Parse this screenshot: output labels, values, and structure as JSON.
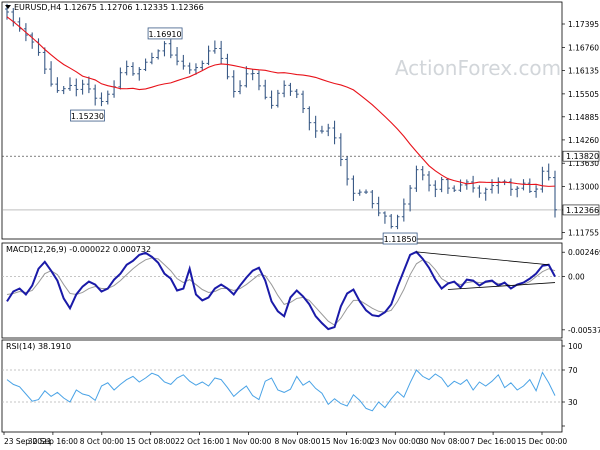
{
  "colors": {
    "candle": "#3a5a86",
    "ma": "#e8121a",
    "macd": "#1a1aa8",
    "signal": "#9a9a9a",
    "rsi": "#4aa3e6",
    "grid": "#b4b4b4",
    "watermark": "#d2d6da"
  },
  "watermark": "ActionForex.com",
  "chart_data": [
    {
      "type": "candlestick",
      "title": "EURUSD,H4  1.12675 1.12706 1.12335 1.12366",
      "ylim": [
        1.1158,
        1.1799
      ],
      "ytick_labels": [
        "1.17395",
        "1.16760",
        "1.16135",
        "1.15505",
        "1.14885",
        "1.14260",
        "1.13630",
        "1.13000",
        "1.12366",
        "1.11755"
      ],
      "ytick_values": [
        1.17395,
        1.1676,
        1.16135,
        1.15505,
        1.14885,
        1.1426,
        1.1363,
        1.13,
        1.12366,
        1.11755
      ],
      "current_price_label": "1.12366",
      "level_price_label": "1.13820",
      "close_path": [
        1.1772,
        1.1746,
        1.1728,
        1.1712,
        1.1695,
        1.1672,
        1.1631,
        1.1582,
        1.1566,
        1.1548,
        1.1588,
        1.1556,
        1.1569,
        1.1583,
        1.1551,
        1.1532,
        1.1529,
        1.1557,
        1.1573,
        1.1615,
        1.1626,
        1.1603,
        1.1617,
        1.1636,
        1.1648,
        1.1664,
        1.1691,
        1.1659,
        1.1641,
        1.1632,
        1.1611,
        1.1624,
        1.1618,
        1.1653,
        1.1682,
        1.1665,
        1.1632,
        1.1574,
        1.1548,
        1.1583,
        1.1612,
        1.1604,
        1.1566,
        1.1538,
        1.1518,
        1.1553,
        1.1574,
        1.1558,
        1.1554,
        1.1517,
        1.1478,
        1.1452,
        1.1445,
        1.1461,
        1.1453,
        1.1398,
        1.1341,
        1.1298,
        1.1267,
        1.1298,
        1.1277,
        1.1242,
        1.1223,
        1.1219,
        1.1185,
        1.1224,
        1.1256,
        1.1298,
        1.1346,
        1.1332,
        1.1305,
        1.1288,
        1.1323,
        1.1298,
        1.1287,
        1.1298,
        1.1318,
        1.1302,
        1.1287,
        1.1276,
        1.1309,
        1.1297,
        1.1324,
        1.1306,
        1.1286,
        1.1299,
        1.1312,
        1.1281,
        1.1295,
        1.1346,
        1.1323,
        1.1237
      ],
      "ma_path": [
        1.1759,
        1.1739,
        1.1716,
        1.1694,
        1.1669,
        1.1647,
        1.1628,
        1.1614,
        1.1596,
        1.1591,
        1.1575,
        1.157,
        1.1563,
        1.1566,
        1.1561,
        1.1568,
        1.1576,
        1.158,
        1.1589,
        1.1597,
        1.1609,
        1.1623,
        1.1632,
        1.163,
        1.1625,
        1.1619,
        1.1616,
        1.1614,
        1.1607,
        1.1608,
        1.1603,
        1.1601,
        1.1596,
        1.1587,
        1.1579,
        1.1573,
        1.1562,
        1.1542,
        1.1521,
        1.1497,
        1.1472,
        1.1445,
        1.1412,
        1.1382,
        1.1353,
        1.1334,
        1.1319,
        1.1313,
        1.1306,
        1.1312,
        1.1311,
        1.1311,
        1.1312,
        1.1308,
        1.1305,
        1.1306,
        1.13,
        1.1301
      ],
      "annotations": [
        {
          "label": "1.16910",
          "price": 1.1691
        },
        {
          "label": "1.15230",
          "price": 1.1523
        },
        {
          "label": "1.11850",
          "price": 1.1185
        }
      ],
      "horizontal_lines": [
        {
          "price": 1.1382,
          "style": "dashed"
        },
        {
          "price": 1.12366,
          "style": "solid"
        }
      ]
    },
    {
      "type": "line",
      "title": "MACD(12,26,9) -0.000022 0.000732",
      "ylim": [
        -0.0062,
        0.0034
      ],
      "ytick_labels": [
        "0.002469",
        "0.00",
        "-0.005375"
      ],
      "ytick_values": [
        0.002469,
        0.0,
        -0.005375
      ],
      "series": [
        {
          "name": "MACD",
          "values": [
            -0.0025,
            -0.0015,
            -0.0012,
            -0.0018,
            -0.0009,
            0.0008,
            0.0015,
            0.0006,
            -0.0004,
            -0.0022,
            -0.0032,
            -0.0018,
            -0.001,
            -0.0005,
            -0.0008,
            -0.0015,
            -0.0012,
            -0.0003,
            0.0003,
            0.0012,
            0.0016,
            0.0022,
            0.0024,
            0.002,
            0.0014,
            0.0003,
            -0.0002,
            -0.0014,
            -0.0012,
            0.0008,
            -0.0018,
            -0.0024,
            -0.0021,
            -0.0012,
            -0.0008,
            -0.0012,
            -0.0018,
            -0.0009,
            -0.0001,
            0.0006,
            0.0009,
            -0.0004,
            -0.0025,
            -0.0035,
            -0.004,
            -0.0021,
            -0.0014,
            -0.002,
            -0.0028,
            -0.004,
            -0.0047,
            -0.0053,
            -0.0051,
            -0.003,
            -0.0017,
            -0.0013,
            -0.0025,
            -0.0034,
            -0.0039,
            -0.004,
            -0.0036,
            -0.0028,
            -0.001,
            0.0006,
            0.0022,
            0.0025,
            0.0018,
            0.0009,
            -0.0003,
            -0.0012,
            -0.0007,
            -0.0005,
            -0.0011,
            -0.0003,
            -0.0004,
            -0.0009,
            -0.0005,
            -0.0004,
            -0.0009,
            -0.0006,
            -0.0012,
            -0.0008,
            -0.0006,
            -0.0002,
            0.0003,
            0.0011,
            0.0012,
            0.0
          ]
        },
        {
          "name": "Signal",
          "values": [
            -0.0018,
            -0.0017,
            -0.0015,
            -0.0016,
            -0.0014,
            -0.0006,
            0.0003,
            0.0006,
            0.0002,
            -0.0008,
            -0.0017,
            -0.0018,
            -0.0016,
            -0.0012,
            -0.001,
            -0.0012,
            -0.0012,
            -0.0009,
            -0.0004,
            0.0002,
            0.0008,
            0.0013,
            0.0017,
            0.0019,
            0.0018,
            0.0012,
            0.0006,
            -0.0002,
            -0.0006,
            -0.0003,
            -0.0008,
            -0.0013,
            -0.0016,
            -0.0015,
            -0.0012,
            -0.0012,
            -0.0014,
            -0.0012,
            -0.0008,
            -0.0003,
            0.0002,
            0.0001,
            -0.0008,
            -0.0019,
            -0.0028,
            -0.0026,
            -0.0022,
            -0.0021,
            -0.0024,
            -0.0031,
            -0.0038,
            -0.0045,
            -0.0049,
            -0.0042,
            -0.0032,
            -0.0024,
            -0.0024,
            -0.0028,
            -0.0032,
            -0.0035,
            -0.0036,
            -0.0034,
            -0.0025,
            -0.0013,
            0.0002,
            0.0013,
            0.0017,
            0.0014,
            0.0007,
            -0.0002,
            -0.0006,
            -0.0006,
            -0.0008,
            -0.0006,
            -0.0005,
            -0.0006,
            -0.0006,
            -0.0005,
            -0.0007,
            -0.0007,
            -0.0009,
            -0.0009,
            -0.0008,
            -0.0005,
            0.0,
            0.0005,
            0.0008,
            0.0006
          ]
        }
      ]
    },
    {
      "type": "line",
      "title": "RSI(14) 38.1910",
      "ylim": [
        0,
        100
      ],
      "ytick_labels": [
        "100",
        "70",
        "30",
        "0"
      ],
      "ytick_values": [
        100,
        70,
        30,
        0
      ],
      "series": [
        {
          "name": "RSI",
          "values": [
            58,
            52,
            49,
            40,
            31,
            33,
            44,
            37,
            42,
            35,
            30,
            45,
            40,
            38,
            32,
            50,
            54,
            45,
            52,
            58,
            62,
            55,
            60,
            66,
            63,
            55,
            52,
            60,
            64,
            56,
            51,
            55,
            50,
            60,
            58,
            48,
            37,
            44,
            50,
            38,
            33,
            56,
            60,
            45,
            42,
            46,
            62,
            51,
            56,
            47,
            41,
            27,
            34,
            28,
            25,
            39,
            32,
            22,
            19,
            30,
            23,
            34,
            43,
            36,
            54,
            70,
            62,
            58,
            65,
            60,
            49,
            56,
            52,
            58,
            45,
            55,
            50,
            56,
            64,
            48,
            54,
            45,
            50,
            58,
            44,
            67,
            54,
            38
          ]
        }
      ]
    }
  ],
  "x_axis_labels": [
    "23 Sep 2021",
    "30 Sep 16:00",
    "8 Oct 00:00",
    "15 Oct 08:00",
    "22 Oct 16:00",
    "1 Nov 00:00",
    "8 Nov 08:00",
    "15 Nov 16:00",
    "23 Nov 00:00",
    "30 Nov 08:00",
    "7 Dec 16:00",
    "15 Dec 00:00"
  ]
}
